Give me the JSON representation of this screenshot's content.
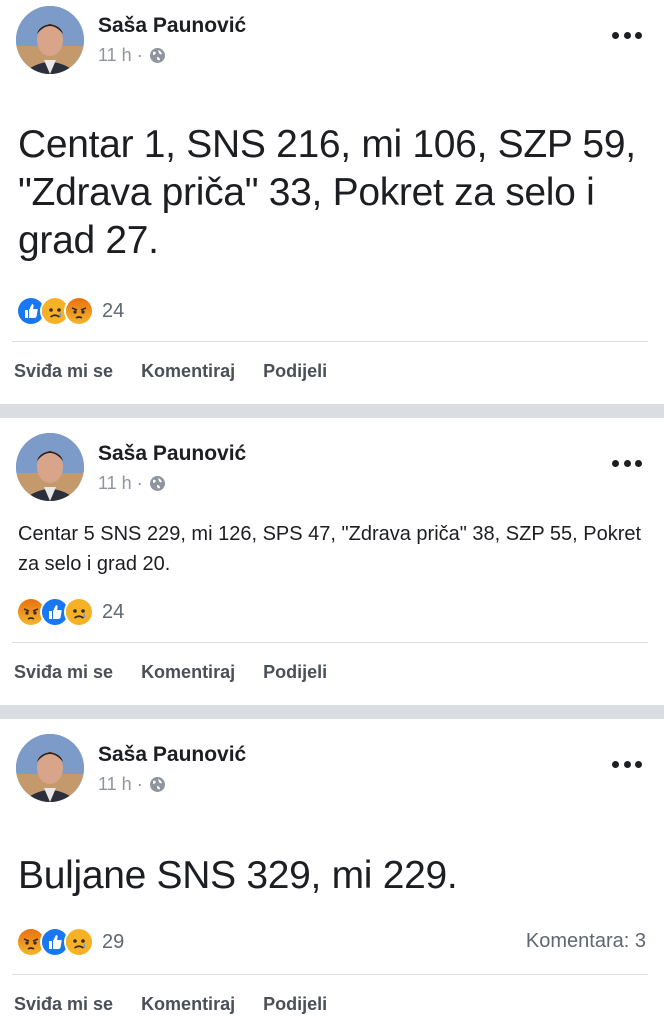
{
  "posts": [
    {
      "author": "Saša Paunović",
      "time": "11 h ·",
      "text": "Centar 1, SNS 216, mi 106, SZP 59, \"Zdrava priča\" 33, Pokret za selo i grad 27.",
      "reactions": [
        "like",
        "sad",
        "angry"
      ],
      "reaction_count": "24",
      "actions": {
        "like": "Sviđa mi se",
        "comment": "Komentiraj",
        "share": "Podijeli"
      }
    },
    {
      "author": "Saša Paunović",
      "time": "11 h ·",
      "text": "Centar 5 SNS 229, mi 126, SPS 47, \"Zdrava priča\" 38, SZP 55, Pokret za selo i grad 20.",
      "reactions": [
        "angry",
        "like",
        "sad"
      ],
      "reaction_count": "24",
      "actions": {
        "like": "Sviđa mi se",
        "comment": "Komentiraj",
        "share": "Podijeli"
      }
    },
    {
      "author": "Saša Paunović",
      "time": "11 h ·",
      "text": "Buljane SNS 329, mi 229.",
      "reactions": [
        "angry",
        "like",
        "sad"
      ],
      "reaction_count": "29",
      "comments_count": "Komentara: 3",
      "actions": {
        "like": "Sviđa mi se",
        "comment": "Komentiraj",
        "share": "Podijeli"
      }
    }
  ],
  "icons": {
    "privacy": "globe-icon",
    "menu": "more-options-icon",
    "reaction_like": "like-reaction-icon",
    "reaction_sad": "sad-reaction-icon",
    "reaction_angry": "angry-reaction-icon"
  },
  "colors": {
    "like_blue": "#1877f2",
    "reaction_yellow": "#f7b125",
    "angry_orange": "#e9710f",
    "separator": "#dadde1",
    "meta_gray": "#90949c"
  }
}
